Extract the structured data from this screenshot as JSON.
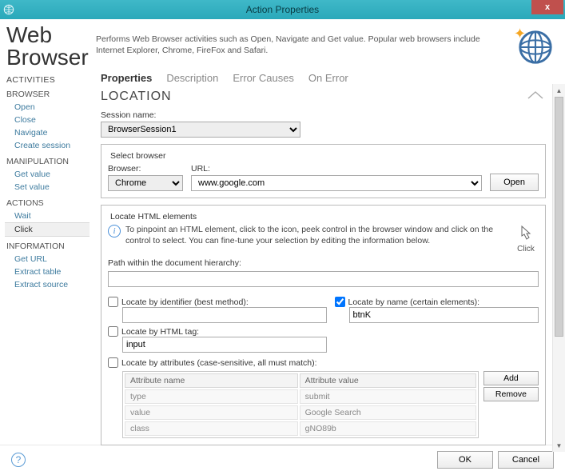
{
  "window": {
    "title": "Action Properties"
  },
  "header": {
    "title_line1": "Web",
    "title_line2": "Browser",
    "description": "Performs Web Browser activities such as Open, Navigate and Get value. Popular web browsers include Internet Explorer, Chrome, FireFox and Safari."
  },
  "sidebar": {
    "heading": "ACTIVITIES",
    "groups": [
      {
        "label": "BROWSER",
        "items": [
          "Open",
          "Close",
          "Navigate",
          "Create session"
        ]
      },
      {
        "label": "MANIPULATION",
        "items": [
          "Get value",
          "Set value"
        ]
      },
      {
        "label": "ACTIONS",
        "items": [
          "Wait",
          "Click"
        ]
      },
      {
        "label": "INFORMATION",
        "items": [
          "Get URL",
          "Extract table",
          "Extract source"
        ]
      }
    ],
    "active": "Click"
  },
  "tabs": {
    "items": [
      "Properties",
      "Description",
      "Error Causes",
      "On Error"
    ],
    "active": "Properties"
  },
  "section": {
    "title": "LOCATION",
    "session_label": "Session name:",
    "session_value": "BrowserSession1",
    "select_browser_legend": "Select browser",
    "browser_label": "Browser:",
    "browser_value": "Chrome",
    "url_label": "URL:",
    "url_value": "www.google.com",
    "open_btn": "Open"
  },
  "locate": {
    "legend": "Locate HTML elements",
    "info": "To pinpoint an HTML element, click to the icon, peek control in the browser window and click on the control to select. You can fine-tune your selection by editing the information below.",
    "click_label": "Click",
    "path_label": "Path within the document hierarchy:",
    "path_value": "",
    "by_id_label": "Locate by identifier (best method):",
    "by_id_checked": false,
    "by_id_value": "",
    "by_name_label": "Locate by name (certain elements):",
    "by_name_checked": true,
    "by_name_value": "btnK",
    "by_tag_label": "Locate by HTML tag:",
    "by_tag_checked": false,
    "by_tag_value": "input",
    "by_attr_label": "Locate by attributes (case-sensitive, all must match):",
    "by_attr_checked": false,
    "attr_headers": {
      "name": "Attribute name",
      "value": "Attribute value"
    },
    "attributes": [
      {
        "name": "type",
        "value": "submit"
      },
      {
        "name": "value",
        "value": "Google Search"
      },
      {
        "name": "class",
        "value": "gNO89b"
      }
    ],
    "add_btn": "Add",
    "remove_btn": "Remove"
  },
  "footer": {
    "ok": "OK",
    "cancel": "Cancel"
  }
}
